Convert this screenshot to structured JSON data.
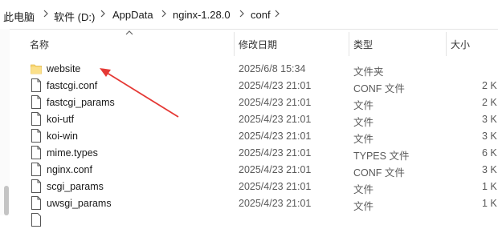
{
  "address": {
    "crumbs": [
      "此电脑",
      "软件 (D:)",
      "AppData",
      "nginx-1.28.0",
      "conf"
    ]
  },
  "columns": {
    "name": "名称",
    "date": "修改日期",
    "type": "类型",
    "size": "大小"
  },
  "files": [
    {
      "name": "website",
      "date": "2025/6/8 15:34",
      "type": "文件夹",
      "size": "",
      "icon": "folder-icon"
    },
    {
      "name": "fastcgi.conf",
      "date": "2025/4/23 21:01",
      "type": "CONF 文件",
      "size": "2 K",
      "icon": "file-icon"
    },
    {
      "name": "fastcgi_params",
      "date": "2025/4/23 21:01",
      "type": "文件",
      "size": "2 K",
      "icon": "file-icon"
    },
    {
      "name": "koi-utf",
      "date": "2025/4/23 21:01",
      "type": "文件",
      "size": "3 K",
      "icon": "file-icon"
    },
    {
      "name": "koi-win",
      "date": "2025/4/23 21:01",
      "type": "文件",
      "size": "3 K",
      "icon": "file-icon"
    },
    {
      "name": "mime.types",
      "date": "2025/4/23 21:01",
      "type": "TYPES 文件",
      "size": "6 K",
      "icon": "file-icon"
    },
    {
      "name": "nginx.conf",
      "date": "2025/4/23 21:01",
      "type": "CONF 文件",
      "size": "3 K",
      "icon": "file-icon"
    },
    {
      "name": "scgi_params",
      "date": "2025/4/23 21:01",
      "type": "文件",
      "size": "1 K",
      "icon": "file-icon"
    },
    {
      "name": "uwsgi_params",
      "date": "2025/4/23 21:01",
      "type": "文件",
      "size": "1 K",
      "icon": "file-icon"
    }
  ],
  "colors": {
    "folder": "#f8d775",
    "annotation_arrow": "#e53935"
  }
}
